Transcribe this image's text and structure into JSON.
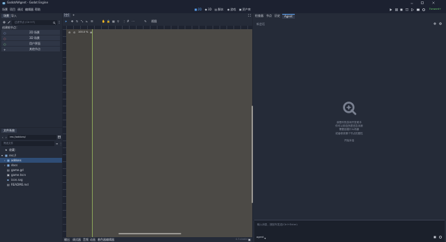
{
  "titlebar": {
    "app_title": "GodotAIAgent - Godot Engine",
    "menus": [
      "场景",
      "项目",
      "调试",
      "编辑器",
      "帮助"
    ],
    "workspaces": [
      "2D",
      "3D",
      "脚本",
      "游戏",
      "资产库"
    ],
    "renderer": "Forward+"
  },
  "left_dock": {
    "tabs": [
      "场景",
      "导入"
    ],
    "filter_placeholder": "过滤节点 (Ctrl+F)",
    "create_root_label": "创建根节点：",
    "root_options": [
      "2D 场景",
      "3D 场景",
      "用户界面",
      "其他节点"
    ]
  },
  "filesystem": {
    "tab": "文件系统",
    "path": "res://addons/",
    "filter_placeholder": "筛选文件",
    "items": [
      {
        "name": "收藏：",
        "type": "favorites"
      },
      {
        "name": "res://",
        "type": "folder"
      },
      {
        "name": "addons",
        "type": "folder"
      },
      {
        "name": "docs",
        "type": "folder"
      },
      {
        "name": "game.gd",
        "type": "gd"
      },
      {
        "name": "game.tscn",
        "type": "tscn"
      },
      {
        "name": "icon.svg",
        "type": "svg"
      },
      {
        "name": "README.md",
        "type": "md"
      }
    ]
  },
  "center": {
    "scene_tab": "[空]",
    "add_tab": "+",
    "view_label": "视图",
    "zoom": "100.0 %",
    "bottom_tabs": [
      "输出",
      "调试器",
      "音频",
      "动画",
      "着色器编辑器"
    ],
    "version": "4.3.stable"
  },
  "right_dock": {
    "tabs": [
      "检查器",
      "节点",
      "历史",
      "Agent"
    ],
    "subheader": "新会话",
    "empty_lines": [
      "我是你的游戏开发助手",
      "你可以用自然语言告诉我",
      "需要创建什么场景",
      "或者修改哪个节点的属性"
    ],
    "empty_sub": "开始对话",
    "input_placeholder": "输入消息，按回车发送(Ctrl+Enter)",
    "mode": "agent"
  },
  "colors": {
    "bg": "#202531",
    "panel": "#252b38",
    "viewport": "#4c4a46",
    "accent": "#5aa1f0",
    "selected_row": "#2f4d76"
  }
}
